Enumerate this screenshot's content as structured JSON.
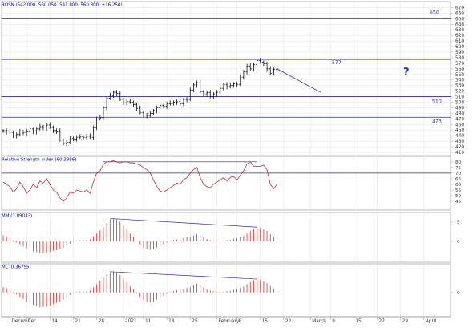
{
  "colors": {
    "frame": "#9a9a9a",
    "grid": "#e2e2e2",
    "level": "#2b2ba8",
    "price": "#111111",
    "rsi": "#c42626",
    "hist": "#d03030",
    "trend": "#2b2ba8",
    "title": "#0000b0",
    "question": "#2233cc",
    "axisText": "#333333"
  },
  "panels": {
    "price": {
      "title": "ROSN (542.000, 560.050, 541.800, 560.300, +16.250)"
    },
    "rsi": {
      "title": "Relative Strength Index (60.3986)"
    },
    "mm": {
      "title": "MM (1.09033)"
    },
    "ml": {
      "title": "ML (0.36755)"
    }
  },
  "annotations": {
    "question_mark": "?"
  },
  "chart_data": [
    {
      "type": "ohlc",
      "panel": "price",
      "title": "ROSN (542.000, 560.050, 541.800, 560.300, +16.250)",
      "ylim": [
        410,
        675
      ],
      "yticks": [
        410,
        420,
        430,
        440,
        450,
        460,
        470,
        480,
        490,
        500,
        510,
        520,
        530,
        540,
        550,
        560,
        570,
        580,
        590,
        600,
        610,
        620,
        630,
        640,
        650,
        660,
        670
      ],
      "x_labels": [
        "Dec",
        "7",
        "14",
        "21",
        "28",
        "2021",
        "11",
        "18",
        "25",
        "Feb",
        "8",
        "15",
        "22",
        "Mar",
        "9",
        "15",
        "22",
        "29",
        "Apr"
      ],
      "x_label_text": [
        "December",
        "7",
        "14",
        "21",
        "28",
        "2021",
        "11",
        "18",
        "25",
        "February",
        "8",
        "15",
        "22",
        "March",
        "9",
        "15",
        "22",
        "29",
        "April"
      ],
      "levels": [
        {
          "value": 650,
          "label": "650"
        },
        {
          "value": 577,
          "label": "577"
        },
        {
          "value": 510,
          "label": "510"
        },
        {
          "value": 473,
          "label": "473"
        }
      ],
      "closes": [
        449,
        447,
        446,
        440,
        442,
        447,
        445,
        448,
        452,
        447,
        452,
        456,
        454,
        459,
        455,
        449,
        448,
        432,
        426,
        428,
        435,
        434,
        437,
        438,
        437,
        439,
        437,
        455,
        470,
        472,
        490,
        507,
        512,
        518,
        516,
        505,
        499,
        501,
        500,
        496,
        489,
        481,
        477,
        476,
        480,
        485,
        490,
        494,
        493,
        497,
        498,
        500,
        501,
        497,
        505,
        505,
        522,
        531,
        535,
        519,
        515,
        517,
        510,
        515,
        518,
        525,
        532,
        528,
        530,
        533,
        532,
        545,
        555,
        565,
        560,
        568,
        575,
        572,
        569,
        560,
        552,
        559,
        560
      ],
      "trend_from": {
        "index": 82,
        "value": 560
      },
      "trend_to": {
        "index": 95,
        "value": 518
      }
    },
    {
      "type": "line",
      "panel": "rsi",
      "title": "Relative Strength Index (60.3986)",
      "ylim": [
        40,
        82
      ],
      "yticks": [
        45,
        50,
        55,
        60,
        65,
        70,
        75,
        80
      ],
      "levels": [
        70
      ],
      "values": [
        62,
        60,
        58,
        53,
        56,
        62,
        58,
        52,
        55,
        60,
        57,
        63,
        61,
        65,
        60,
        55,
        53,
        48,
        45,
        48,
        53,
        52,
        55,
        54,
        53,
        55,
        52,
        62,
        70,
        72,
        78,
        80,
        80,
        81,
        80,
        79,
        80,
        80,
        79,
        79,
        78,
        77,
        75,
        73,
        70,
        64,
        58,
        54,
        53,
        55,
        57,
        59,
        61,
        60,
        64,
        66,
        70,
        73,
        75,
        66,
        60,
        58,
        57,
        60,
        62,
        64,
        66,
        63,
        66,
        67,
        64,
        68,
        72,
        78,
        80,
        76,
        76,
        76,
        77,
        73,
        60,
        56,
        60
      ],
      "trend_from": {
        "index": 30,
        "value": 80
      },
      "trend_to": {
        "index": 76,
        "value": 80
      }
    },
    {
      "type": "bar",
      "panel": "mm",
      "title": "MM (1.09033)",
      "ylim": [
        -4.5,
        6.5
      ],
      "yticks": [
        0,
        5
      ],
      "values": [
        1.5,
        1.3,
        0.8,
        0.2,
        -0.3,
        -0.8,
        -1.3,
        -1.8,
        -2.3,
        -2.6,
        -2.8,
        -3.0,
        -3.0,
        -2.9,
        -2.7,
        -2.4,
        -2.2,
        -2.0,
        -1.6,
        -1.1,
        -0.6,
        -0.1,
        0.1,
        0.2,
        0.3,
        0.4,
        0.6,
        1.2,
        2.0,
        2.8,
        3.6,
        4.6,
        5.6,
        5.8,
        5.6,
        5.0,
        4.0,
        3.0,
        2.0,
        1.0,
        0.0,
        -0.8,
        -1.6,
        -2.0,
        -2.2,
        -2.0,
        -1.6,
        -1.2,
        -0.8,
        -0.3,
        0.1,
        0.3,
        0.5,
        0.6,
        0.8,
        1.0,
        1.2,
        1.5,
        1.8,
        1.5,
        1.0,
        0.6,
        0.3,
        0.1,
        0.1,
        0.1,
        0.2,
        0.3,
        0.4,
        0.6,
        0.8,
        1.0,
        1.4,
        2.0,
        2.6,
        3.2,
        3.6,
        3.4,
        3.0,
        2.6,
        1.8,
        1.2,
        0.8
      ],
      "trend_from": {
        "index": 32,
        "value": 5.8
      },
      "trend_to": {
        "index": 76,
        "value": 3.6
      }
    },
    {
      "type": "bar",
      "panel": "ml",
      "title": "ML (0.36755)",
      "ylim": [
        -4.5,
        5.5
      ],
      "yticks": [
        0
      ],
      "values": [
        1.2,
        1.0,
        0.6,
        0.1,
        -0.4,
        -0.9,
        -1.4,
        -1.9,
        -2.4,
        -2.7,
        -2.9,
        -3.1,
        -3.1,
        -3.0,
        -2.8,
        -2.5,
        -2.2,
        -1.9,
        -1.5,
        -1.0,
        -0.5,
        -0.1,
        0.1,
        0.2,
        0.3,
        0.3,
        0.5,
        1.1,
        1.8,
        2.5,
        3.2,
        3.9,
        4.4,
        4.5,
        4.3,
        3.8,
        3.0,
        2.2,
        1.4,
        0.6,
        -0.2,
        -0.9,
        -1.5,
        -1.9,
        -2.1,
        -1.9,
        -1.5,
        -1.1,
        -0.7,
        -0.3,
        0.1,
        0.3,
        0.5,
        0.6,
        0.8,
        1.0,
        1.2,
        1.6,
        1.9,
        1.6,
        1.1,
        0.7,
        0.4,
        0.2,
        0.1,
        0.1,
        0.2,
        0.3,
        0.4,
        0.6,
        0.8,
        1.0,
        1.3,
        1.8,
        2.3,
        2.7,
        2.9,
        2.7,
        2.4,
        2.0,
        1.4,
        0.9,
        0.4
      ],
      "trend_from": {
        "index": 32,
        "value": 4.5
      },
      "trend_to": {
        "index": 76,
        "value": 2.9
      }
    }
  ]
}
